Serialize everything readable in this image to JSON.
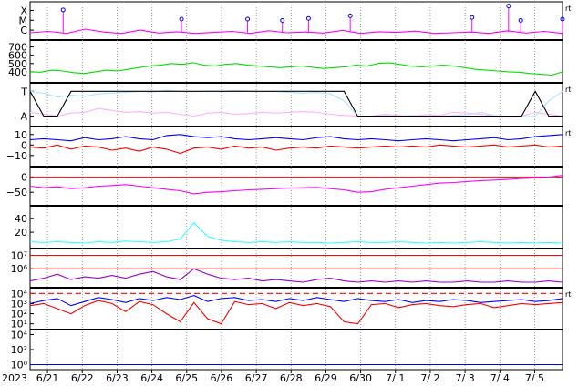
{
  "chart_data": {
    "type": "line",
    "title": "",
    "year_label": "2023",
    "x_tick_labels": [
      "6/21",
      "6/22",
      "6/23",
      "6/24",
      "6/25",
      "6/26",
      "6/27",
      "6/28",
      "6/29",
      "6/30",
      "7/ 1",
      "7/ 2",
      "7/ 3",
      "7/ 4",
      "7/ 5"
    ],
    "x_range_days": [
      0,
      15.3
    ],
    "colors": {
      "magenta": "#ff00ff",
      "green": "#00e000",
      "lightblue": "#aee4ff",
      "pink": "#ffb0ff",
      "blue": "#0000ff",
      "red": "#ff0000",
      "violet": "#cc33ff",
      "cyan": "#33ffff",
      "purple": "#9900cc",
      "black": "#000000"
    },
    "panels": [
      {
        "id": "xmc",
        "y_tick_labels": [
          "X",
          "M",
          "C"
        ],
        "right_marker": "rt",
        "series": [
          {
            "color": "magenta",
            "values": [
              0.14,
              0.18,
              0.12,
              0.25,
              0.16,
              0.12,
              0.22,
              0.13,
              0.17,
              0.12,
              0.15,
              0.18,
              0.12,
              0.2,
              0.14,
              0.16,
              0.13,
              0.21,
              0.12,
              0.17,
              0.15,
              0.19,
              0.12,
              0.14,
              0.16,
              0.12,
              0.2,
              0.13,
              0.18,
              0.12
            ]
          }
        ],
        "flare_peaks": [
          {
            "day": 1.95,
            "level": 0.78
          },
          {
            "day": 5.35,
            "level": 0.5
          },
          {
            "day": 7.25,
            "level": 0.5
          },
          {
            "day": 8.25,
            "level": 0.46
          },
          {
            "day": 9.0,
            "level": 0.52
          },
          {
            "day": 10.2,
            "level": 0.6
          },
          {
            "day": 13.7,
            "level": 0.55
          },
          {
            "day": 14.75,
            "level": 0.9
          },
          {
            "day": 15.1,
            "level": 0.46
          },
          {
            "day": 16.3,
            "level": 0.5
          }
        ]
      },
      {
        "id": "speed",
        "y_tick_labels": [
          "700",
          "600",
          "500",
          "400"
        ],
        "y_range": [
          300,
          750
        ],
        "series": [
          {
            "color": "green",
            "values": [
              400,
              395,
              420,
              410,
              390,
              380,
              400,
              420,
              410,
              430,
              450,
              470,
              480,
              500,
              490,
              510,
              480,
              470,
              490,
              500,
              480,
              470,
              460,
              450,
              460,
              470,
              455,
              440,
              450,
              460,
              480,
              470,
              500,
              510,
              490,
              470,
              460,
              470,
              480,
              470,
              450,
              430,
              420,
              410,
              400,
              395,
              380,
              370,
              360,
              400
            ]
          }
        ]
      },
      {
        "id": "ta",
        "y_tick_labels": [
          "T",
          "A"
        ],
        "right_marker": "rt",
        "series": [
          {
            "color": "lightblue",
            "values": [
              0.85,
              0.8,
              0.7,
              0.75,
              0.72,
              0.78,
              0.8,
              0.82,
              0.85,
              0.83,
              0.88,
              0.85,
              0.84,
              0.86,
              0.85,
              0.87,
              0.86,
              0.84,
              0.85,
              0.82,
              0.8,
              0.82,
              0.78,
              0.6,
              0.2,
              0.2,
              0.22,
              0.2,
              0.22,
              0.2,
              0.2,
              0.22,
              0.24,
              0.3,
              0.22,
              0.2,
              0.18,
              0.2,
              0.6,
              0.85
            ]
          },
          {
            "color": "pink",
            "values": [
              0.3,
              0.25,
              0.2,
              0.28,
              0.3,
              0.4,
              0.35,
              0.3,
              0.32,
              0.28,
              0.3,
              0.25,
              0.2,
              0.28,
              0.3,
              0.25,
              0.27,
              0.3,
              0.28,
              0.3,
              0.32,
              0.3,
              0.25,
              0.22,
              0.2,
              0.2,
              0.25,
              0.22,
              0.2,
              0.24,
              0.22,
              0.3,
              0.28,
              0.25,
              0.2,
              0.18,
              0.2,
              0.3,
              0.25,
              0.2
            ]
          },
          {
            "color": "black",
            "values": [
              0.85,
              0.2,
              0.2,
              0.85,
              0.85,
              0.85,
              0.85,
              0.85,
              0.85,
              0.85,
              0.85,
              0.85,
              0.85,
              0.85,
              0.85,
              0.85,
              0.85,
              0.85,
              0.85,
              0.85,
              0.85,
              0.85,
              0.85,
              0.85,
              0.2,
              0.2,
              0.2,
              0.2,
              0.2,
              0.2,
              0.2,
              0.2,
              0.2,
              0.2,
              0.2,
              0.2,
              0.2,
              0.85,
              0.2,
              0.2
            ]
          }
        ]
      },
      {
        "id": "bfield",
        "y_tick_labels": [
          "10",
          "0",
          "−10"
        ],
        "y_range": [
          -18,
          15
        ],
        "right_marker": "rt",
        "series": [
          {
            "color": "blue",
            "values": [
              5,
              6,
              5,
              4,
              7,
              5,
              6,
              8,
              6,
              5,
              9,
              10,
              8,
              7,
              8,
              6,
              5,
              6,
              7,
              6,
              5,
              7,
              8,
              6,
              5,
              6,
              5,
              4,
              5,
              6,
              5,
              4,
              5,
              6,
              7,
              5,
              6,
              8,
              9,
              10
            ]
          },
          {
            "color": "red",
            "values": [
              -2,
              -3,
              0,
              -4,
              -1,
              -2,
              -5,
              -3,
              -6,
              -2,
              -4,
              -8,
              -3,
              -2,
              -4,
              -1,
              -3,
              -2,
              -5,
              -3,
              -2,
              -3,
              -1,
              -2,
              -3,
              -2,
              -1,
              -2,
              -1,
              -2,
              0,
              -1,
              -2,
              -1,
              0,
              -2,
              -1,
              0,
              -2,
              -1
            ]
          }
        ]
      },
      {
        "id": "panel5",
        "y_tick_labels": [
          "0",
          "−50"
        ],
        "y_range": [
          -85,
          25
        ],
        "reference_value": 0,
        "series": [
          {
            "color": "magenta",
            "values": [
              -30,
              -35,
              -32,
              -38,
              -35,
              -30,
              -28,
              -25,
              -30,
              -35,
              -40,
              -45,
              -55,
              -50,
              -48,
              -45,
              -42,
              -40,
              -38,
              -36,
              -35,
              -34,
              -38,
              -42,
              -50,
              -48,
              -40,
              -35,
              -30,
              -25,
              -20,
              -18,
              -15,
              -12,
              -10,
              -8,
              -5,
              -3,
              0,
              5
            ]
          }
        ]
      },
      {
        "id": "panel6",
        "y_tick_labels": [
          "40",
          "20"
        ],
        "y_range": [
          0,
          55
        ],
        "series": [
          {
            "color": "cyan",
            "values": [
              6,
              5,
              6,
              5,
              4,
              6,
              5,
              7,
              6,
              5,
              6,
              10,
              34,
              14,
              8,
              6,
              5,
              6,
              5,
              6,
              5,
              5,
              4,
              5,
              6,
              5,
              5,
              6,
              5,
              4,
              5,
              4,
              5,
              6,
              5,
              4,
              5,
              4,
              5,
              4
            ]
          }
        ]
      },
      {
        "id": "panel7",
        "y_tick_labels": [
          "10⁷",
          "10⁶"
        ],
        "log_range": [
          4.8,
          7.3
        ],
        "reference_logs": [
          7,
          6
        ],
        "series": [
          {
            "color": "purple",
            "values": [
              5.1,
              5.3,
              5.6,
              5.2,
              5.4,
              5.3,
              5.5,
              5.3,
              5.6,
              5.8,
              5.4,
              5.2,
              6.0,
              5.6,
              5.3,
              5.2,
              5.3,
              5.1,
              5.2,
              5.1,
              5.0,
              5.2,
              5.3,
              5.1,
              5.0,
              5.1,
              5.0,
              5.1,
              5.0,
              5.1,
              5.0,
              5.0,
              5.1,
              5.0,
              5.0,
              5.1,
              5.0,
              5.0,
              5.1,
              5.0
            ]
          }
        ]
      },
      {
        "id": "panel8",
        "y_tick_labels": [
          "10⁴",
          "10³",
          "10²",
          "10¹"
        ],
        "log_range": [
          0.7,
          4.3
        ],
        "reference_log": 4,
        "right_marker": "rt",
        "series": [
          {
            "color": "blue",
            "values": [
              3.0,
              3.3,
              3.5,
              2.8,
              3.2,
              3.6,
              3.4,
              3.1,
              3.5,
              3.3,
              3.6,
              3.4,
              3.8,
              3.2,
              3.5,
              3.6,
              3.3,
              3.4,
              3.2,
              3.5,
              3.3,
              3.6,
              3.4,
              3.2,
              3.5,
              3.3,
              3.2,
              3.4,
              3.1,
              3.3,
              3.2,
              3.4,
              3.3,
              3.1,
              3.2,
              3.3,
              3.4,
              3.2,
              3.3,
              3.5
            ]
          },
          {
            "color": "red",
            "values": [
              2.8,
              3.0,
              2.5,
              2.0,
              2.8,
              3.3,
              3.0,
              2.2,
              3.2,
              2.9,
              2.0,
              1.2,
              3.1,
              1.5,
              1.0,
              3.2,
              2.9,
              3.0,
              2.5,
              3.1,
              2.8,
              3.0,
              2.7,
              1.2,
              1.0,
              2.9,
              3.0,
              2.6,
              2.9,
              3.0,
              2.8,
              2.7,
              2.9,
              3.0,
              2.6,
              2.8,
              3.0,
              2.9,
              3.0,
              3.1
            ]
          }
        ]
      },
      {
        "id": "panel9",
        "y_tick_labels": [
          "10⁴",
          "10²",
          "10⁰"
        ],
        "log_range": [
          -0.3,
          4.3
        ],
        "series": [
          {
            "color": "blue",
            "values": [
              0,
              0,
              0,
              0,
              0,
              0,
              0,
              0,
              0,
              0,
              0,
              0,
              0,
              0,
              0,
              0,
              0,
              0,
              0,
              0,
              0,
              0,
              0,
              0,
              0,
              0,
              0,
              0,
              0,
              0,
              0,
              0,
              0,
              0,
              0,
              0,
              0,
              0,
              0,
              0
            ]
          }
        ]
      }
    ]
  }
}
